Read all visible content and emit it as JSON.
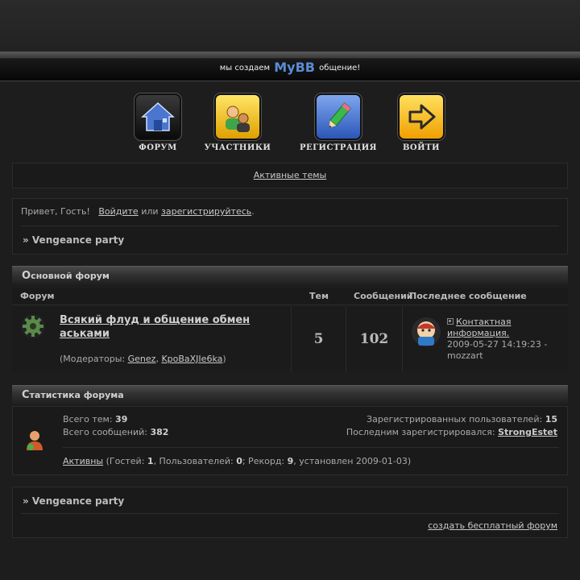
{
  "banner": {
    "prefix": "мы создаем",
    "brand": "MyBB",
    "suffix": "общение!"
  },
  "nav": [
    {
      "label": "ФОРУМ",
      "icon": "home-icon"
    },
    {
      "label": "УЧАСТНИКИ",
      "icon": "users-icon"
    },
    {
      "label": "РЕГИСТРАЦИЯ",
      "icon": "pencil-icon"
    },
    {
      "label": "ВОЙТИ",
      "icon": "login-arrow-icon"
    }
  ],
  "active_topics": "Активные темы",
  "welcome": {
    "greeting": "Привет, Гость!",
    "login": "Войдите",
    "or": "или",
    "register": "зарегистрируйтесь",
    "dot": "."
  },
  "breadcrumb": "» Vengeance party",
  "main_forum": {
    "category_first": "О",
    "category_rest": "сновной форум",
    "headers": {
      "forum": "Форум",
      "topics": "Тем",
      "posts": "Сообщений",
      "last": "Последнее сообщение"
    },
    "forum": {
      "title": "Всякий флуд и общение обмен аськами",
      "moderators_label": "(Модераторы: ",
      "moderator1": "Genez",
      "comma": ", ",
      "moderator2": "KpoBaXJIe6ka",
      "moderators_close": ")",
      "topics": "5",
      "posts": "102",
      "last_title": "Контактная информация.",
      "last_date": "2009-05-27 14:19:23 -",
      "last_user": "mozzart"
    }
  },
  "stats": {
    "category_first": "С",
    "category_rest": "татистика форума",
    "total_topics_label": "Всего тем: ",
    "total_topics": "39",
    "total_posts_label": "Всего сообщений: ",
    "total_posts": "382",
    "registered_label": "Зарегистрированных пользователей: ",
    "registered": "15",
    "last_registered_label": "Последним зарегистрировался: ",
    "last_registered": "StrongEstet",
    "active_link": "Активны",
    "guests_label": " (Гостей: ",
    "guests": "1",
    "users_label": ", Пользователей: ",
    "users": "0",
    "record_label": "; Рекорд: ",
    "record": "9",
    "record_date": ", установлен 2009-01-03)"
  },
  "footer": {
    "create": "создать бесплатный форум"
  },
  "colors": {
    "background": "#1d1d1d",
    "brand": "#5b8bd6",
    "text": "#aaaaaa"
  }
}
